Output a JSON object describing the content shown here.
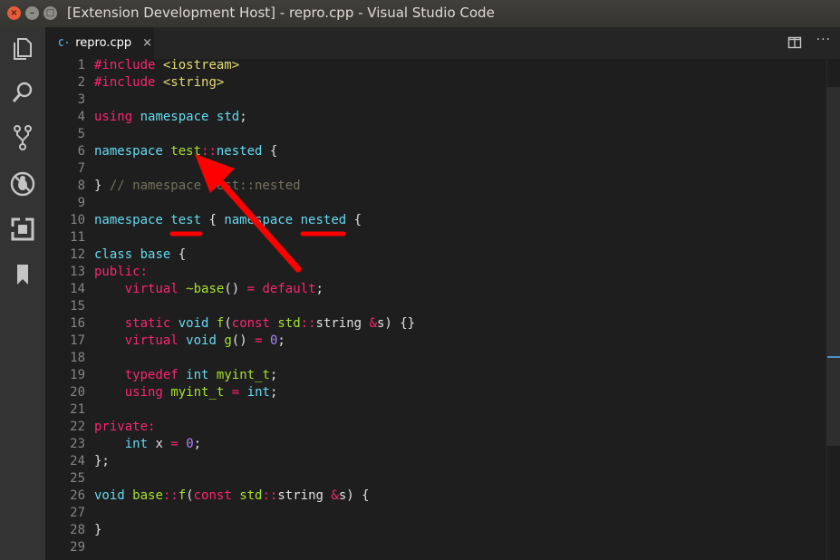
{
  "window": {
    "title": "[Extension Development Host] - repro.cpp - Visual Studio Code",
    "close_glyph": "×",
    "minimize_glyph": "–",
    "maximize_glyph": "□"
  },
  "activity_bar": {
    "icons": [
      "files-icon",
      "search-icon",
      "source-control-icon",
      "debug-icon",
      "extensions-icon",
      "bookmark-icon"
    ]
  },
  "tab": {
    "icon_text": "C·",
    "label": "repro.cpp",
    "close": "×"
  },
  "editor_actions": {
    "more": "···"
  },
  "colors": {
    "keyword": "#f92672",
    "type": "#66d9ef",
    "function": "#a6e22e",
    "string": "#e6db74",
    "number": "#ae81ff",
    "comment": "#75715e",
    "annotation": "#ff0000"
  },
  "code": {
    "lines": [
      {
        "n": "1",
        "tokens": [
          {
            "t": "#include",
            "c": "kw"
          },
          {
            "t": " "
          },
          {
            "t": "<iostream>",
            "c": "st"
          }
        ]
      },
      {
        "n": "2",
        "tokens": [
          {
            "t": "#include",
            "c": "kw"
          },
          {
            "t": " "
          },
          {
            "t": "<string>",
            "c": "st"
          }
        ]
      },
      {
        "n": "3",
        "tokens": []
      },
      {
        "n": "4",
        "tokens": [
          {
            "t": "using",
            "c": "kw"
          },
          {
            "t": " "
          },
          {
            "t": "namespace",
            "c": "ty"
          },
          {
            "t": " "
          },
          {
            "t": "std",
            "c": "ty"
          },
          {
            "t": ";"
          }
        ]
      },
      {
        "n": "5",
        "tokens": []
      },
      {
        "n": "6",
        "tokens": [
          {
            "t": "namespace",
            "c": "ty"
          },
          {
            "t": " "
          },
          {
            "t": "test",
            "c": "fn"
          },
          {
            "t": "::",
            "c": "kw"
          },
          {
            "t": "nested",
            "c": "ty"
          },
          {
            "t": " {"
          }
        ]
      },
      {
        "n": "7",
        "tokens": []
      },
      {
        "n": "8",
        "tokens": [
          {
            "t": "} "
          },
          {
            "t": "// namespace test::nested",
            "c": "cm"
          }
        ]
      },
      {
        "n": "9",
        "tokens": []
      },
      {
        "n": "10",
        "tokens": [
          {
            "t": "namespace",
            "c": "ty"
          },
          {
            "t": " "
          },
          {
            "t": "test",
            "c": "ty"
          },
          {
            "t": " { "
          },
          {
            "t": "namespace",
            "c": "ty"
          },
          {
            "t": " "
          },
          {
            "t": "nested",
            "c": "ty"
          },
          {
            "t": " {"
          }
        ]
      },
      {
        "n": "11",
        "tokens": []
      },
      {
        "n": "12",
        "tokens": [
          {
            "t": "class",
            "c": "ty"
          },
          {
            "t": " "
          },
          {
            "t": "base",
            "c": "ty"
          },
          {
            "t": " {"
          }
        ]
      },
      {
        "n": "13",
        "tokens": [
          {
            "t": "public:",
            "c": "kw"
          }
        ]
      },
      {
        "n": "14",
        "tokens": [
          {
            "t": "    "
          },
          {
            "t": "virtual",
            "c": "kw"
          },
          {
            "t": " "
          },
          {
            "t": "~base",
            "c": "fn"
          },
          {
            "t": "() "
          },
          {
            "t": "=",
            "c": "kw"
          },
          {
            "t": " "
          },
          {
            "t": "default",
            "c": "kw"
          },
          {
            "t": ";"
          }
        ]
      },
      {
        "n": "15",
        "tokens": []
      },
      {
        "n": "16",
        "tokens": [
          {
            "t": "    "
          },
          {
            "t": "static",
            "c": "kw"
          },
          {
            "t": " "
          },
          {
            "t": "void",
            "c": "ty"
          },
          {
            "t": " "
          },
          {
            "t": "f",
            "c": "fn"
          },
          {
            "t": "("
          },
          {
            "t": "const",
            "c": "kw"
          },
          {
            "t": " "
          },
          {
            "t": "std",
            "c": "fn"
          },
          {
            "t": "::",
            "c": "kw"
          },
          {
            "t": "string"
          },
          {
            "t": " "
          },
          {
            "t": "&",
            "c": "kw"
          },
          {
            "t": "s) {}"
          }
        ]
      },
      {
        "n": "17",
        "tokens": [
          {
            "t": "    "
          },
          {
            "t": "virtual",
            "c": "kw"
          },
          {
            "t": " "
          },
          {
            "t": "void",
            "c": "ty"
          },
          {
            "t": " "
          },
          {
            "t": "g",
            "c": "fn"
          },
          {
            "t": "() "
          },
          {
            "t": "=",
            "c": "kw"
          },
          {
            "t": " "
          },
          {
            "t": "0",
            "c": "nu"
          },
          {
            "t": ";"
          }
        ]
      },
      {
        "n": "18",
        "tokens": []
      },
      {
        "n": "19",
        "tokens": [
          {
            "t": "    "
          },
          {
            "t": "typedef",
            "c": "kw"
          },
          {
            "t": " "
          },
          {
            "t": "int",
            "c": "ty"
          },
          {
            "t": " "
          },
          {
            "t": "myint_t",
            "c": "fn"
          },
          {
            "t": ";"
          }
        ]
      },
      {
        "n": "20",
        "tokens": [
          {
            "t": "    "
          },
          {
            "t": "using",
            "c": "kw"
          },
          {
            "t": " "
          },
          {
            "t": "myint_t",
            "c": "fn"
          },
          {
            "t": " "
          },
          {
            "t": "=",
            "c": "kw"
          },
          {
            "t": " "
          },
          {
            "t": "int",
            "c": "ty"
          },
          {
            "t": ";"
          }
        ]
      },
      {
        "n": "21",
        "tokens": []
      },
      {
        "n": "22",
        "tokens": [
          {
            "t": "private:",
            "c": "kw"
          }
        ]
      },
      {
        "n": "23",
        "tokens": [
          {
            "t": "    "
          },
          {
            "t": "int",
            "c": "ty"
          },
          {
            "t": " x "
          },
          {
            "t": "=",
            "c": "kw"
          },
          {
            "t": " "
          },
          {
            "t": "0",
            "c": "nu"
          },
          {
            "t": ";"
          }
        ]
      },
      {
        "n": "24",
        "tokens": [
          {
            "t": "};"
          }
        ]
      },
      {
        "n": "25",
        "tokens": []
      },
      {
        "n": "26",
        "tokens": [
          {
            "t": "void",
            "c": "ty"
          },
          {
            "t": " "
          },
          {
            "t": "base",
            "c": "fn"
          },
          {
            "t": "::",
            "c": "kw"
          },
          {
            "t": "f",
            "c": "fn"
          },
          {
            "t": "("
          },
          {
            "t": "const",
            "c": "kw"
          },
          {
            "t": " "
          },
          {
            "t": "std",
            "c": "fn"
          },
          {
            "t": "::",
            "c": "kw"
          },
          {
            "t": "string"
          },
          {
            "t": " "
          },
          {
            "t": "&",
            "c": "kw"
          },
          {
            "t": "s) {"
          }
        ]
      },
      {
        "n": "27",
        "tokens": []
      },
      {
        "n": "28",
        "tokens": [
          {
            "t": "}"
          }
        ]
      },
      {
        "n": "29",
        "tokens": []
      }
    ]
  }
}
